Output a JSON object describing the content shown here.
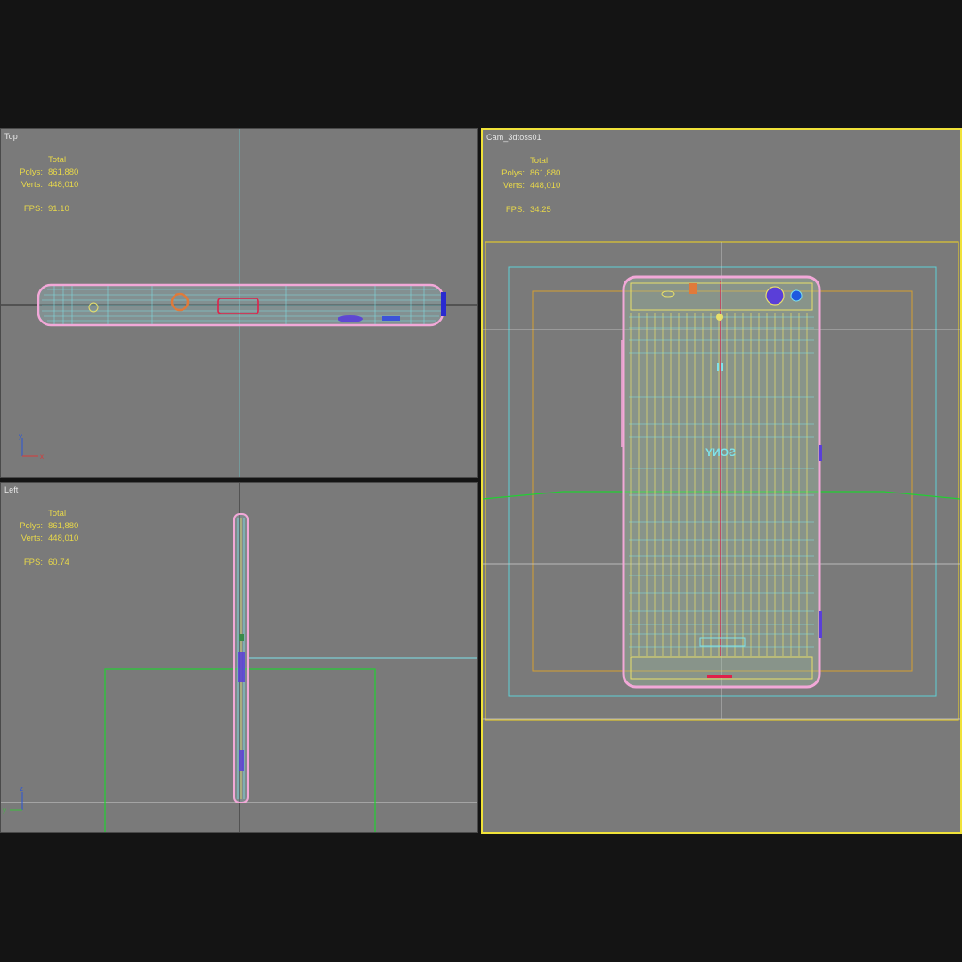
{
  "viewports": {
    "top": {
      "label": "Top",
      "stats": {
        "header": "Total",
        "polys_label": "Polys:",
        "polys": "861,880",
        "verts_label": "Verts:",
        "verts": "448,010",
        "fps_label": "FPS:",
        "fps": "91.10"
      },
      "axis_labels": {
        "a": "y",
        "b": "x"
      }
    },
    "left": {
      "label": "Left",
      "stats": {
        "header": "Total",
        "polys_label": "Polys:",
        "polys": "861,880",
        "verts_label": "Verts:",
        "verts": "448,010",
        "fps_label": "FPS:",
        "fps": "60.74"
      },
      "axis_labels": {
        "a": "z",
        "b": "y"
      }
    },
    "camera": {
      "label": "Cam_3dtoss01",
      "stats": {
        "header": "Total",
        "polys_label": "Polys:",
        "polys": "861,880",
        "verts_label": "Verts:",
        "verts": "448,010",
        "fps_label": "FPS:",
        "fps": "34.25"
      },
      "brand_mirrored": "SONY"
    }
  },
  "colors": {
    "viewport_bg": "#7a7a7a",
    "active_border": "#f0e23a",
    "stats_text": "#e8d84a",
    "wire_pink": "#f2a8d8",
    "wire_cyan": "#7fe3ea",
    "wire_yellow": "#e8e06a",
    "safe_orange": "#d6a030",
    "grid_green": "#22d032"
  }
}
